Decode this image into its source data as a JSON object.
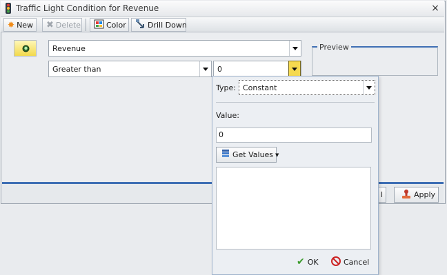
{
  "window": {
    "title": "Traffic Light Condition for  Revenue",
    "close_glyph": "×"
  },
  "toolbar": {
    "new_label": "New",
    "delete_label": "Delete",
    "color_label": "Color",
    "drilldown_label": "Drill Down"
  },
  "condition": {
    "field_value": "Revenue",
    "operator_value": "Greater than",
    "compare_value": "0"
  },
  "preview": {
    "label": "Preview"
  },
  "footer": {
    "apply_label": "Apply",
    "hidden_button_text": "l"
  },
  "popup": {
    "type_label": "Type:",
    "type_value": "Constant",
    "value_label": "Value:",
    "value_input": "0",
    "get_values_label": "Get Values",
    "ok_label": "OK",
    "cancel_label": "Cancel"
  },
  "colors": {
    "accent_blue": "#3f6fb4",
    "highlight_yellow": "#f5d94f",
    "light_green": "#3a9a2a",
    "cancel_red": "#cc2222"
  }
}
